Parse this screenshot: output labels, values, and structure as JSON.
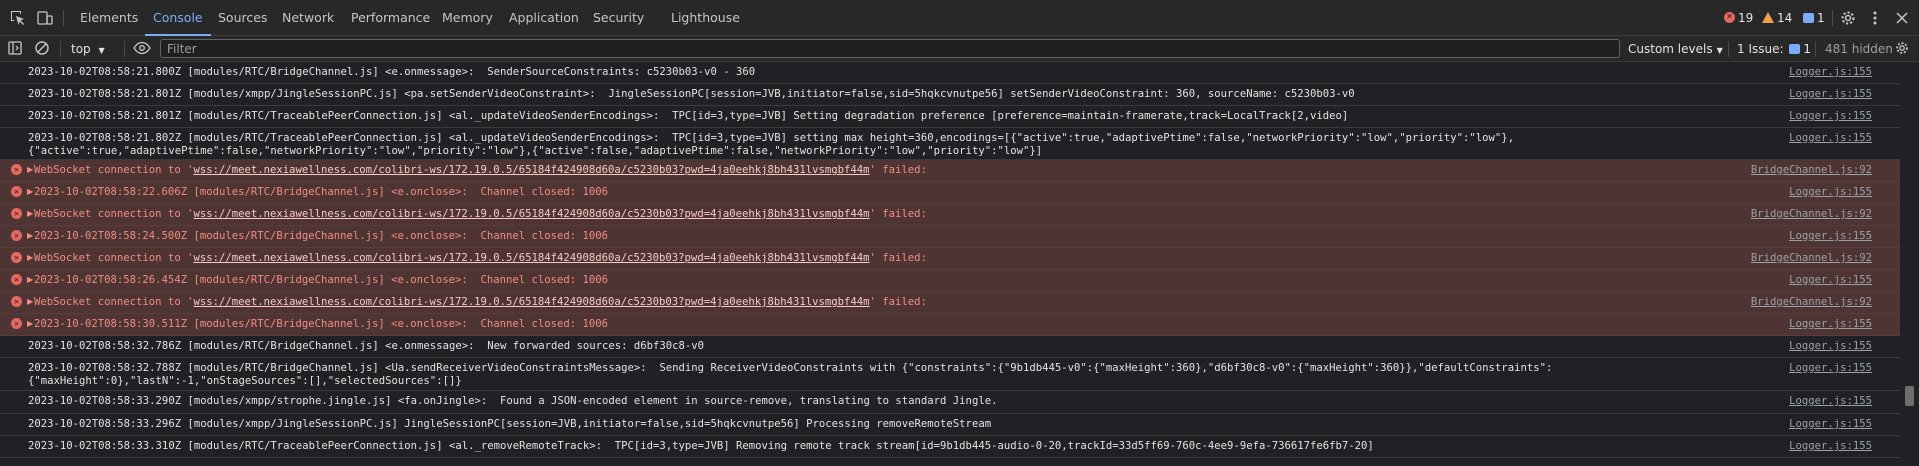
{
  "tabs": [
    {
      "label": "Elements",
      "active": false
    },
    {
      "label": "Console",
      "active": true
    },
    {
      "label": "Sources",
      "active": false
    },
    {
      "label": "Network",
      "active": false
    },
    {
      "label": "Performance",
      "active": false
    },
    {
      "label": "Memory",
      "active": false
    },
    {
      "label": "Application",
      "active": false
    },
    {
      "label": "Security",
      "active": false
    },
    {
      "label": "Lighthouse",
      "active": false
    }
  ],
  "counts": {
    "errors": "19",
    "warnings": "14",
    "messages": "1"
  },
  "toolbar": {
    "context": "top",
    "filter_placeholder": "Filter",
    "levels": "Custom levels",
    "issues_label": "1 Issue:",
    "issues_count": "1",
    "hidden": "481 hidden"
  },
  "log": [
    {
      "level": "info",
      "text": "2023-10-02T08:58:21.800Z [modules/RTC/BridgeChannel.js] <e.onmessage>:  SenderSourceConstraints: c5230b03-v0 - 360",
      "source": "Logger.js:155"
    },
    {
      "level": "info",
      "text": "2023-10-02T08:58:21.801Z [modules/xmpp/JingleSessionPC.js] <pa.setSenderVideoConstraint>:  JingleSessionPC[session=JVB,initiator=false,sid=5hqkcvnutpe56] setSenderVideoConstraint: 360, sourceName: c5230b03-v0",
      "source": "Logger.js:155"
    },
    {
      "level": "info",
      "text": "2023-10-02T08:58:21.801Z [modules/RTC/TraceablePeerConnection.js] <al._updateVideoSenderEncodings>:  TPC[id=3,type=JVB] Setting degradation preference [preference=maintain-framerate,track=LocalTrack[2,video]",
      "source": "Logger.js:155"
    },
    {
      "level": "info",
      "text": "2023-10-02T08:58:21.802Z [modules/RTC/TraceablePeerConnection.js] <al._updateVideoSenderEncodings>:  TPC[id=3,type=JVB] setting max height=360,encodings=[{\"active\":true,\"adaptivePtime\":false,\"networkPriority\":\"low\",\"priority\":\"low\"},",
      "text2": "{\"active\":true,\"adaptivePtime\":false,\"networkPriority\":\"low\",\"priority\":\"low\"},{\"active\":false,\"adaptivePtime\":false,\"networkPriority\":\"low\",\"priority\":\"low\"}]",
      "source": "Logger.js:155"
    },
    {
      "level": "error",
      "prefix": "WebSocket connection to '",
      "url": "wss://meet.nexiawellness.com/colibri-ws/172.19.0.5/65184f424908d60a/c5230b03?pwd=4ja0eehkj8bh431lvsmgbf44m",
      "suffix": "' failed:",
      "source": "BridgeChannel.js:92"
    },
    {
      "level": "error",
      "text": "2023-10-02T08:58:22.606Z [modules/RTC/BridgeChannel.js] <e.onclose>:  Channel closed: 1006",
      "source": "Logger.js:155"
    },
    {
      "level": "error",
      "prefix": "WebSocket connection to '",
      "url": "wss://meet.nexiawellness.com/colibri-ws/172.19.0.5/65184f424908d60a/c5230b03?pwd=4ja0eehkj8bh431lvsmgbf44m",
      "suffix": "' failed:",
      "source": "BridgeChannel.js:92"
    },
    {
      "level": "error",
      "text": "2023-10-02T08:58:24.500Z [modules/RTC/BridgeChannel.js] <e.onclose>:  Channel closed: 1006",
      "source": "Logger.js:155"
    },
    {
      "level": "error",
      "prefix": "WebSocket connection to '",
      "url": "wss://meet.nexiawellness.com/colibri-ws/172.19.0.5/65184f424908d60a/c5230b03?pwd=4ja0eehkj8bh431lvsmgbf44m",
      "suffix": "' failed:",
      "source": "BridgeChannel.js:92"
    },
    {
      "level": "error",
      "text": "2023-10-02T08:58:26.454Z [modules/RTC/BridgeChannel.js] <e.onclose>:  Channel closed: 1006",
      "source": "Logger.js:155"
    },
    {
      "level": "error",
      "prefix": "WebSocket connection to '",
      "url": "wss://meet.nexiawellness.com/colibri-ws/172.19.0.5/65184f424908d60a/c5230b03?pwd=4ja0eehkj8bh431lvsmgbf44m",
      "suffix": "' failed:",
      "source": "BridgeChannel.js:92"
    },
    {
      "level": "error",
      "text": "2023-10-02T08:58:30.511Z [modules/RTC/BridgeChannel.js] <e.onclose>:  Channel closed: 1006",
      "source": "Logger.js:155"
    },
    {
      "level": "info",
      "text": "2023-10-02T08:58:32.786Z [modules/RTC/BridgeChannel.js] <e.onmessage>:  New forwarded sources: d6bf30c8-v0",
      "source": "Logger.js:155"
    },
    {
      "level": "info",
      "text": "2023-10-02T08:58:32.788Z [modules/RTC/BridgeChannel.js] <Ua.sendReceiverVideoConstraintsMessage>:  Sending ReceiverVideoConstraints with {\"constraints\":{\"9b1db445-v0\":{\"maxHeight\":360},\"d6bf30c8-v0\":{\"maxHeight\":360}},\"defaultConstraints\":",
      "text2": "{\"maxHeight\":0},\"lastN\":-1,\"onStageSources\":[],\"selectedSources\":[]}",
      "source": "Logger.js:155"
    },
    {
      "level": "info",
      "text": "2023-10-02T08:58:33.290Z [modules/xmpp/strophe.jingle.js] <fa.onJingle>:  Found a JSON-encoded element in source-remove, translating to standard Jingle.",
      "source": "Logger.js:155"
    },
    {
      "level": "info",
      "text": "2023-10-02T08:58:33.296Z [modules/xmpp/JingleSessionPC.js] JingleSessionPC[session=JVB,initiator=false,sid=5hqkcvnutpe56] Processing removeRemoteStream",
      "source": "Logger.js:155"
    },
    {
      "level": "info",
      "text": "2023-10-02T08:58:33.310Z [modules/RTC/TraceablePeerConnection.js] <al._removeRemoteTrack>:  TPC[id=3,type=JVB] Removing remote track stream[id=9b1db445-audio-0-20,trackId=33d5ff69-760c-4ee9-9efa-736617fe6fb7-20]",
      "source": "Logger.js:155"
    }
  ]
}
